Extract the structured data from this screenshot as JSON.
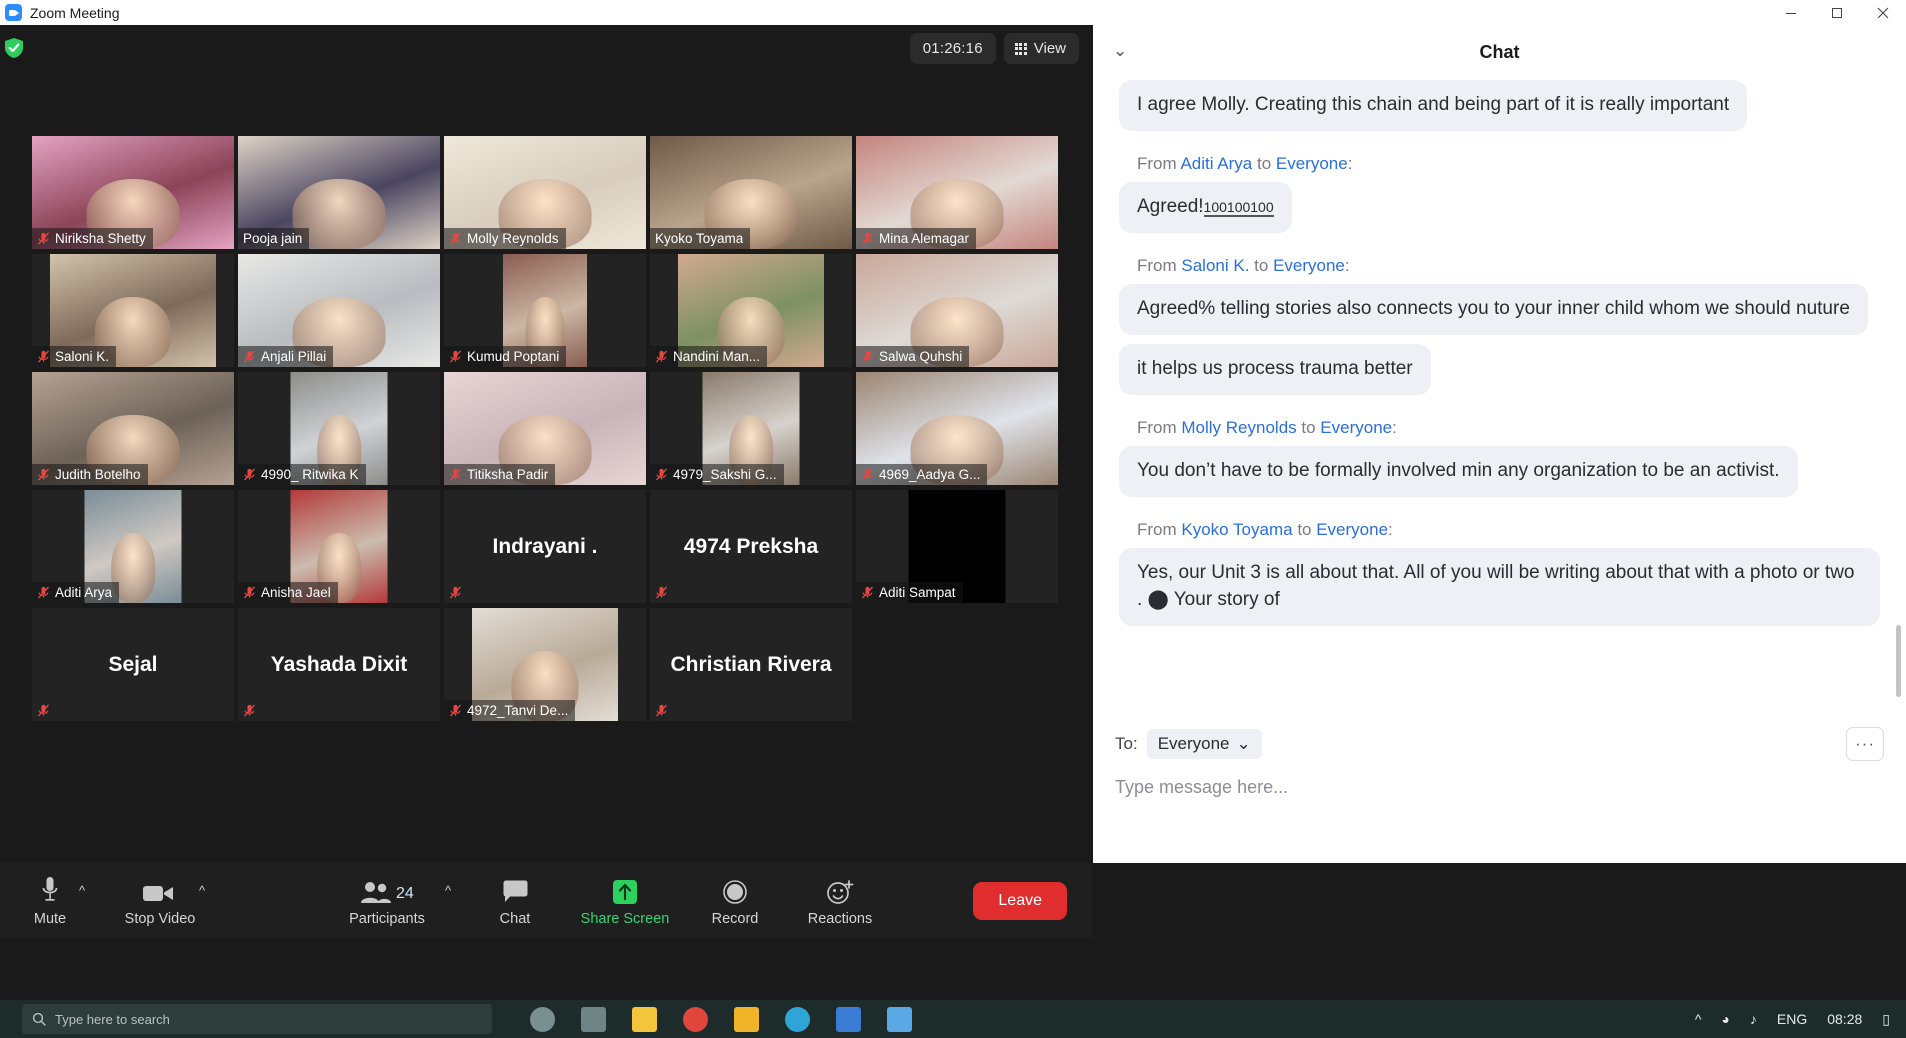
{
  "window": {
    "title": "Zoom Meeting",
    "app_icon": "zoom-logo-icon",
    "minimize": "minimize-icon",
    "restore": "restore-icon",
    "close": "close-icon"
  },
  "header": {
    "security_icon": "shield-check-icon",
    "timer": "01:26:16",
    "view_label": "View",
    "view_icon": "grid-view-icon"
  },
  "participants_grid": {
    "rows": [
      [
        {
          "name": "Niriksha Shetty",
          "muted": true,
          "active": false,
          "video": true,
          "style": "full",
          "bg": "#8b4458",
          "bg2": "#e4a3c2"
        },
        {
          "name": "Pooja jain",
          "muted": false,
          "active": true,
          "video": true,
          "style": "full",
          "bg": "#4a4560",
          "bg2": "#ded3c6"
        },
        {
          "name": "Molly Reynolds",
          "muted": true,
          "active": false,
          "video": true,
          "style": "full",
          "bg": "#d8cdbd",
          "bg2": "#efe8da"
        },
        {
          "name": "Kyoko Toyama",
          "muted": false,
          "active": false,
          "video": true,
          "style": "full",
          "bg": "#b9a48c",
          "bg2": "#6e5a47"
        },
        {
          "name": "Mina Alemagar",
          "muted": true,
          "active": false,
          "video": true,
          "style": "full",
          "bg": "#e3d9d4",
          "bg2": "#c4847e"
        }
      ],
      [
        {
          "name": "Saloni K.",
          "muted": true,
          "active": false,
          "video": true,
          "style": "w166",
          "bg": "#7d6a5a",
          "bg2": "#d3c3ab"
        },
        {
          "name": "Anjali Pillai",
          "muted": true,
          "active": false,
          "video": true,
          "style": "full",
          "bg": "#b9bcc0",
          "bg2": "#e8e8e6"
        },
        {
          "name": "Kumud Poptani",
          "muted": true,
          "active": false,
          "video": true,
          "style": "w84",
          "bg": "#cbb7a4",
          "bg2": "#8a5d52"
        },
        {
          "name": "Nandini Man...",
          "muted": true,
          "active": false,
          "video": true,
          "style": "mid",
          "bg": "#7d9163",
          "bg2": "#d2a98f"
        },
        {
          "name": "Salwa Quhshi",
          "muted": true,
          "active": false,
          "video": true,
          "style": "full",
          "bg": "#dedad6",
          "bg2": "#c9a79a"
        }
      ],
      [
        {
          "name": "Judith Botelho",
          "muted": true,
          "active": false,
          "video": true,
          "style": "full",
          "bg": "#6d6257",
          "bg2": "#b5a294"
        },
        {
          "name": "4990_ Ritwika K",
          "muted": true,
          "active": false,
          "video": true,
          "style": "narrow",
          "bg": "#cfd3d6",
          "bg2": "#8d8c8a"
        },
        {
          "name": "Titiksha Padir",
          "muted": true,
          "active": false,
          "video": true,
          "style": "full",
          "bg": "#c9b4b9",
          "bg2": "#e7d6d4"
        },
        {
          "name": "4979_Sakshi G...",
          "muted": true,
          "active": false,
          "video": true,
          "style": "narrow",
          "bg": "#d6d2cd",
          "bg2": "#8a7a6c"
        },
        {
          "name": "4969_Aadya G...",
          "muted": true,
          "active": false,
          "video": true,
          "style": "full",
          "bg": "#dfe3ea",
          "bg2": "#9b8572"
        }
      ],
      [
        {
          "name": "Aditi Arya",
          "muted": true,
          "active": false,
          "video": true,
          "style": "narrow",
          "bg": "#cfc9c3",
          "bg2": "#7a8d97"
        },
        {
          "name": "Anisha Jael",
          "muted": true,
          "active": false,
          "video": true,
          "style": "narrow",
          "bg": "#cbbcae",
          "bg2": "#b33a3a"
        },
        {
          "name": "Indrayani .",
          "muted": true,
          "active": false,
          "video": false,
          "style": "name",
          "bg": "#232323",
          "bg2": "#232323"
        },
        {
          "name": "4974 Preksha",
          "muted": true,
          "active": false,
          "video": false,
          "style": "name",
          "bg": "#232323",
          "bg2": "#232323"
        },
        {
          "name": "Aditi Sampat",
          "muted": true,
          "active": false,
          "video": true,
          "style": "black",
          "bg": "#000000",
          "bg2": "#000000"
        }
      ],
      [
        {
          "name": "Sejal",
          "muted": true,
          "active": false,
          "video": false,
          "style": "name",
          "bg": "#232323",
          "bg2": "#232323"
        },
        {
          "name": "Yashada Dixit",
          "muted": true,
          "active": false,
          "video": false,
          "style": "name",
          "bg": "#232323",
          "bg2": "#232323"
        },
        {
          "name": "4972_Tanvi De...",
          "muted": true,
          "active": false,
          "video": true,
          "style": "mid",
          "bg": "#b9aa98",
          "bg2": "#e2ddd6"
        },
        {
          "name": "Christian Rivera",
          "muted": true,
          "active": false,
          "video": false,
          "style": "name",
          "bg": "#232323",
          "bg2": "#232323"
        }
      ]
    ]
  },
  "toolbar": {
    "mute_label": "Mute",
    "mute_icon": "microphone-icon",
    "video_label": "Stop Video",
    "video_icon": "video-camera-icon",
    "participants_label": "Participants",
    "participants_icon": "people-icon",
    "participants_count": "24",
    "chat_label": "Chat",
    "chat_icon": "speech-bubble-icon",
    "share_label": "Share Screen",
    "share_icon": "share-arrow-icon",
    "record_label": "Record",
    "record_icon": "record-circle-icon",
    "reactions_label": "Reactions",
    "reactions_icon": "smiley-plus-icon",
    "leave_label": "Leave",
    "caret_icon": "chevron-up-icon",
    "share_color": "#3ad179",
    "leave_color": "#e02d2d"
  },
  "chat": {
    "title": "Chat",
    "collapse_icon": "chevron-down-icon",
    "messages": [
      {
        "from": null,
        "to": null,
        "text": "I agree Molly. Creating this chain and being part of it is really important"
      },
      {
        "from": "Aditi Arya",
        "to": "Everyone",
        "text": "Agreed!",
        "suffix": "100100100"
      },
      {
        "from": "Saloni K.",
        "to": "Everyone",
        "text": "Agreed% telling stories also connects you to your inner child whom we should nuture"
      },
      {
        "from": null,
        "to": null,
        "text": "it helps us process trauma better"
      },
      {
        "from": "Molly Reynolds",
        "to": "Everyone",
        "text": "You don’t have to be formally involved min any organization to be an activist."
      },
      {
        "from": "Kyoko Toyama",
        "to": "Everyone",
        "text": "Yes, our Unit 3 is all about that.   All of you will be writing about that with a photo or two .  ⬤     Your story of"
      }
    ],
    "from_prefix": "From",
    "to_word": "to",
    "to_label": "To:",
    "to_value": "Everyone",
    "to_caret": "chevron-down-icon",
    "more_icon": "more-options-icon",
    "more_label": "···",
    "input_placeholder": "Type message here...",
    "link_color": "#2a6fdb"
  },
  "taskbar": {
    "search_icon": "search-icon",
    "search_placeholder": "Type here to search",
    "language": "ENG",
    "clock": "08:28",
    "notification_icon": "notification-icon"
  }
}
